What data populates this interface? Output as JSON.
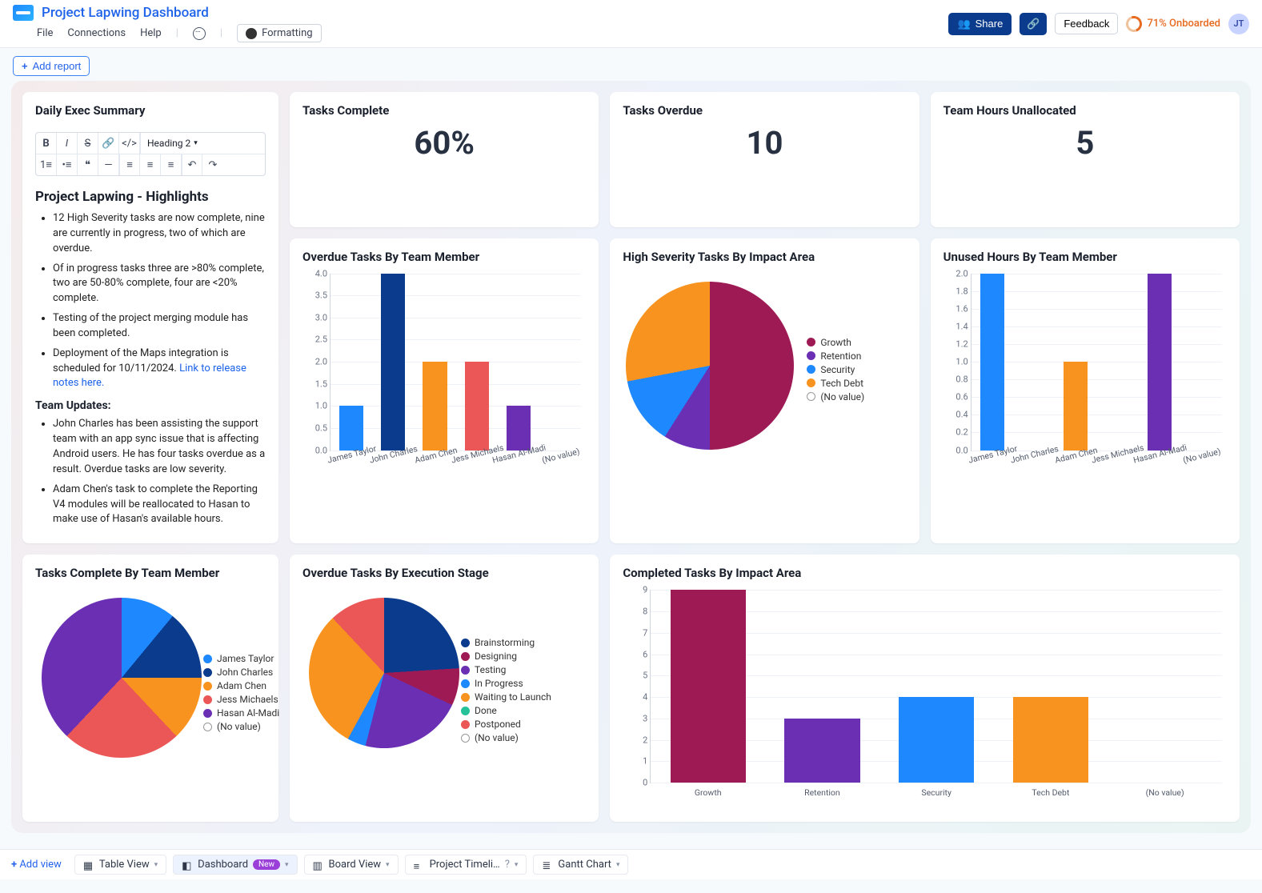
{
  "header": {
    "title": "Project Lapwing Dashboard",
    "menu": {
      "file": "File",
      "connections": "Connections",
      "help": "Help",
      "formatting": "Formatting"
    },
    "share": "Share",
    "feedback": "Feedback",
    "onboarded": "71% Onboarded",
    "avatar": "JT"
  },
  "add_report": "Add report",
  "summary": {
    "title": "Daily Exec Summary",
    "heading_select": "Heading 2",
    "h2": "Project Lapwing - Highlights",
    "highlights": [
      "12 High Severity tasks are now complete, nine are currently in progress, two of which are overdue.",
      "Of in progress tasks three are >80% complete,  two are      50-80% complete, four are <20% complete.",
      "Testing of the project merging module has been completed.",
      "Deployment of the Maps integration is scheduled for 10/11/2024. "
    ],
    "release_link": "Link to release notes here.",
    "team_updates_heading": "Team Updates:",
    "team_updates": [
      "John Charles has been assisting the support team with an app sync issue that is affecting Android users. He has four tasks overdue as a result. Overdue tasks are low severity.",
      "Adam Chen's task to complete the Reporting V4 modules will be reallocated to Hasan to make use of Hasan's available hours."
    ]
  },
  "kpi": {
    "tasks_complete": {
      "label": "Tasks Complete",
      "value": "60%"
    },
    "tasks_overdue": {
      "label": "Tasks Overdue",
      "value": "10"
    },
    "team_hours": {
      "label": "Team Hours Unallocated",
      "value": "5"
    }
  },
  "colors": {
    "blue": "#1e88ff",
    "navy": "#0b3b8c",
    "orange": "#f7931e",
    "red": "#eb5757",
    "purple": "#6b2fb3",
    "maroon": "#9e1a55",
    "teal": "#25c29a"
  },
  "people": [
    "James Taylor",
    "John Charles",
    "Adam Chen",
    "Jess Michaels",
    "Hasan Al-Madi",
    "(No value)"
  ],
  "chart_data": {
    "overdue_by_member": {
      "title": "Overdue Tasks By Team Member",
      "type": "bar",
      "categories": [
        "James Taylor",
        "John Charles",
        "Adam Chen",
        "Jess Michaels",
        "Hasan Al-Madi",
        "(No value)"
      ],
      "values": [
        1,
        4,
        2,
        2,
        1,
        0
      ],
      "colors": [
        "blue",
        "navy",
        "orange",
        "red",
        "purple",
        null
      ],
      "ylim": [
        0,
        4
      ],
      "ystep": 0.5
    },
    "unused_hours": {
      "title": "Unused Hours By Team Member",
      "type": "bar",
      "categories": [
        "James Taylor",
        "John Charles",
        "Adam Chen",
        "Jess Michaels",
        "Hasan Al-Madi",
        "(No value)"
      ],
      "values": [
        2,
        0,
        1,
        0,
        2,
        0
      ],
      "colors": [
        "blue",
        "navy",
        "orange",
        "red",
        "purple",
        null
      ],
      "ylim": [
        0,
        2
      ],
      "ystep": 0.2
    },
    "high_severity_pie": {
      "title": "High Severity Tasks By Impact Area",
      "type": "pie",
      "series": [
        {
          "name": "Growth",
          "value": 50,
          "color": "maroon"
        },
        {
          "name": "Retention",
          "value": 9,
          "color": "purple"
        },
        {
          "name": "Security",
          "value": 13,
          "color": "blue"
        },
        {
          "name": "Tech Debt",
          "value": 28,
          "color": "orange"
        },
        {
          "name": "(No value)",
          "value": 0,
          "color": "hollow"
        }
      ]
    },
    "tasks_complete_pie": {
      "title": "Tasks Complete By Team Member",
      "type": "pie",
      "series": [
        {
          "name": "James Taylor",
          "value": 11,
          "color": "blue"
        },
        {
          "name": "John Charles",
          "value": 14,
          "color": "navy"
        },
        {
          "name": "Adam Chen",
          "value": 13,
          "color": "orange"
        },
        {
          "name": "Jess Michaels",
          "value": 24,
          "color": "red"
        },
        {
          "name": "Hasan Al-Madi",
          "value": 38,
          "color": "purple"
        },
        {
          "name": "(No value)",
          "value": 0,
          "color": "hollow"
        }
      ]
    },
    "overdue_by_stage_pie": {
      "title": "Overdue Tasks By Execution Stage",
      "type": "pie",
      "series": [
        {
          "name": "Brainstorming",
          "value": 24,
          "color": "navy"
        },
        {
          "name": "Designing",
          "value": 8,
          "color": "maroon"
        },
        {
          "name": "Testing",
          "value": 22,
          "color": "purple"
        },
        {
          "name": "In Progress",
          "value": 4,
          "color": "blue"
        },
        {
          "name": "Waiting to Launch",
          "value": 30,
          "color": "orange"
        },
        {
          "name": "Done",
          "value": 0,
          "color": "teal"
        },
        {
          "name": "Postponed",
          "value": 12,
          "color": "red"
        },
        {
          "name": "(No value)",
          "value": 0,
          "color": "hollow"
        }
      ]
    },
    "completed_by_impact": {
      "title": "Completed Tasks By Impact Area",
      "type": "bar",
      "categories": [
        "Growth",
        "Retention",
        "Security",
        "Tech Debt",
        "(No value)"
      ],
      "values": [
        9,
        3,
        4,
        4,
        0
      ],
      "colors": [
        "maroon",
        "purple",
        "blue",
        "orange",
        null
      ],
      "ylim": [
        0,
        9
      ],
      "ystep": 1
    }
  },
  "views": {
    "add": "Add view",
    "tabs": [
      {
        "label": "Table View",
        "icon": "table"
      },
      {
        "label": "Dashboard",
        "icon": "dashboard",
        "badge": "New",
        "active": true
      },
      {
        "label": "Board View",
        "icon": "board"
      },
      {
        "label": "Project Timeli…",
        "icon": "timeline",
        "help": true
      },
      {
        "label": "Gantt Chart",
        "icon": "gantt"
      }
    ]
  }
}
